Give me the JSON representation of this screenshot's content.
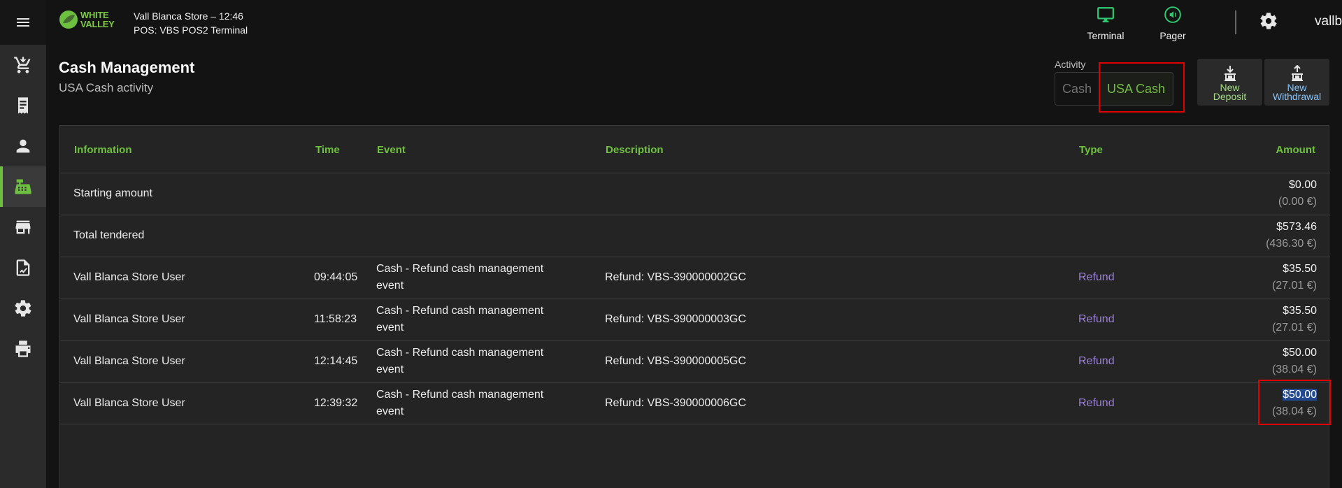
{
  "header": {
    "logo_line1": "WHITE",
    "logo_line2": "VALLEY",
    "store_line": "Vall Blanca Store – 12:46",
    "pos_line": "POS: VBS POS2 Terminal",
    "terminal_label": "Terminal",
    "pager_label": "Pager",
    "username": "vallblanca"
  },
  "sidebar": {
    "items": [
      {
        "icon": "cart-icon"
      },
      {
        "icon": "receipt-icon"
      },
      {
        "icon": "person-icon"
      },
      {
        "icon": "cash-register-icon",
        "active": true
      },
      {
        "icon": "store-icon"
      },
      {
        "icon": "report-icon"
      },
      {
        "icon": "gear-icon"
      },
      {
        "icon": "printer-icon"
      }
    ]
  },
  "page": {
    "title": "Cash Management",
    "subtitle": "USA Cash activity"
  },
  "activity": {
    "label": "Activity",
    "options": [
      "Cash",
      "USA Cash"
    ],
    "selected": "USA Cash"
  },
  "buttons": {
    "deposit_line1": "New",
    "deposit_line2": "Deposit",
    "withdraw_line1": "New",
    "withdraw_line2": "Withdrawal"
  },
  "table": {
    "headers": {
      "information": "Information",
      "time": "Time",
      "event": "Event",
      "description": "Description",
      "type": "Type",
      "amount": "Amount"
    },
    "summary": [
      {
        "information": "Starting amount",
        "amount": "$0.00",
        "amount_eur": "(0.00 €)"
      },
      {
        "information": "Total tendered",
        "amount": "$573.46",
        "amount_eur": "(436.30 €)"
      }
    ],
    "rows": [
      {
        "information": "Vall Blanca Store User",
        "time": "09:44:05",
        "event_line1": "Cash - Refund cash management",
        "event_line2": "event",
        "description": "Refund: VBS-390000002GC",
        "type": "Refund",
        "amount": "$35.50",
        "amount_eur": "(27.01 €)"
      },
      {
        "information": "Vall Blanca Store User",
        "time": "11:58:23",
        "event_line1": "Cash - Refund cash management",
        "event_line2": "event",
        "description": "Refund: VBS-390000003GC",
        "type": "Refund",
        "amount": "$35.50",
        "amount_eur": "(27.01 €)"
      },
      {
        "information": "Vall Blanca Store User",
        "time": "12:14:45",
        "event_line1": "Cash - Refund cash management",
        "event_line2": "event",
        "description": "Refund: VBS-390000005GC",
        "type": "Refund",
        "amount": "$50.00",
        "amount_eur": "(38.04 €)"
      },
      {
        "information": "Vall Blanca Store User",
        "time": "12:39:32",
        "event_line1": "Cash - Refund cash management",
        "event_line2": "event",
        "description": "Refund: VBS-390000006GC",
        "type": "Refund",
        "amount": "$50.00",
        "amount_eur": "(38.04 €)"
      }
    ]
  },
  "colors": {
    "accent_green": "#6fc23f",
    "type_purple": "#9b82d6",
    "highlight_red": "#e00000",
    "terminal_icon": "#2ecc71",
    "pager_icon": "#2ecc71"
  }
}
